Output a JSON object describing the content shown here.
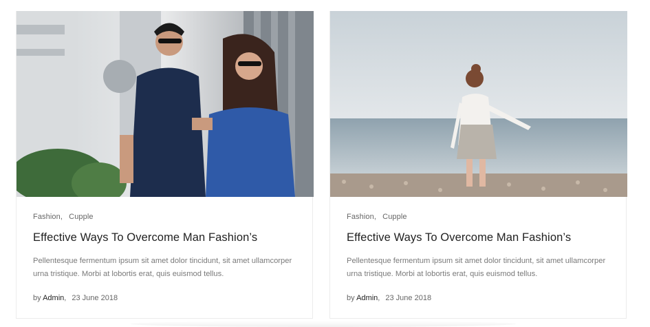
{
  "posts": [
    {
      "categories": [
        "Fashion",
        "Cupple"
      ],
      "title": "Effective Ways To Overcome Man Fashion’s",
      "excerpt": "Pellentesque fermentum ipsum sit amet dolor tincidunt, sit amet ullamcorper urna tristique. Morbi at lobortis erat, quis euismod tellus.",
      "by_label": "by",
      "author": "Admin",
      "date": "23 June 2018",
      "image": "couple-photo"
    },
    {
      "categories": [
        "Fashion",
        "Cupple"
      ],
      "title": "Effective Ways To Overcome Man Fashion’s",
      "excerpt": "Pellentesque fermentum ipsum sit amet dolor tincidunt, sit amet ullamcorper urna tristique. Morbi at lobortis erat, quis euismod tellus.",
      "by_label": "by",
      "author": "Admin",
      "date": "23 June 2018",
      "image": "beach-girl-photo"
    }
  ],
  "colors": {
    "title": "#1f1f1f",
    "text": "#7a7a7a",
    "meta": "#666666",
    "border": "#ececec"
  }
}
